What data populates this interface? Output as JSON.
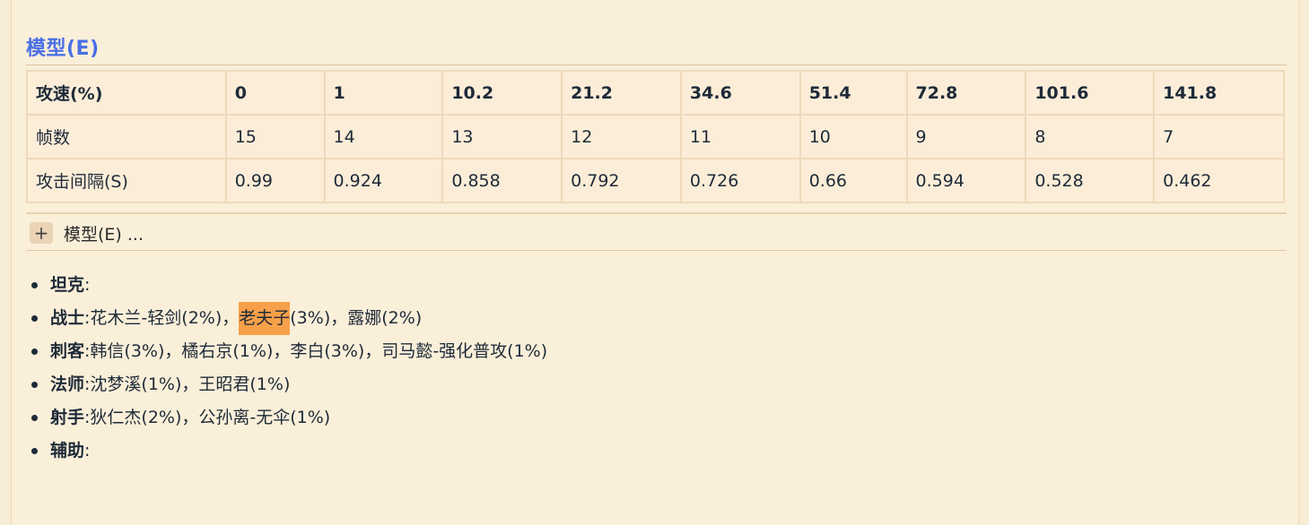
{
  "section": {
    "title": "模型(E)",
    "expander_label": "模型(E) ...",
    "expander_icon": "plus-icon"
  },
  "table": {
    "rows": [
      [
        "攻速(%)",
        "0",
        "1",
        "10.2",
        "21.2",
        "34.6",
        "51.4",
        "72.8",
        "101.6",
        "141.8"
      ],
      [
        "帧数",
        "15",
        "14",
        "13",
        "12",
        "11",
        "10",
        "9",
        "8",
        "7"
      ],
      [
        "攻击间隔(S)",
        "0.99",
        "0.924",
        "0.858",
        "0.792",
        "0.726",
        "0.66",
        "0.594",
        "0.528",
        "0.462"
      ]
    ]
  },
  "roles": [
    {
      "name": "坦克",
      "sep": ":",
      "parts": []
    },
    {
      "name": "战士",
      "sep": ":",
      "parts": [
        "花木兰-轻剑(2%)，",
        "老夫子",
        "(3%)，露娜(2%)"
      ]
    },
    {
      "name": "刺客",
      "sep": ":",
      "parts": [
        "韩信(3%)，橘右京(1%)，李白(3%)，司马懿-强化普攻(1%)"
      ]
    },
    {
      "name": "法师",
      "sep": ":",
      "parts": [
        "沈梦溪(1%)，王昭君(1%)"
      ]
    },
    {
      "name": "射手",
      "sep": ":",
      "parts": [
        "狄仁杰(2%)，公孙离-无伞(1%)"
      ]
    },
    {
      "name": "辅助",
      "sep": ":",
      "parts": []
    }
  ],
  "colors": {
    "heading": "#4a6fe6",
    "highlight": "#f7a04a"
  }
}
